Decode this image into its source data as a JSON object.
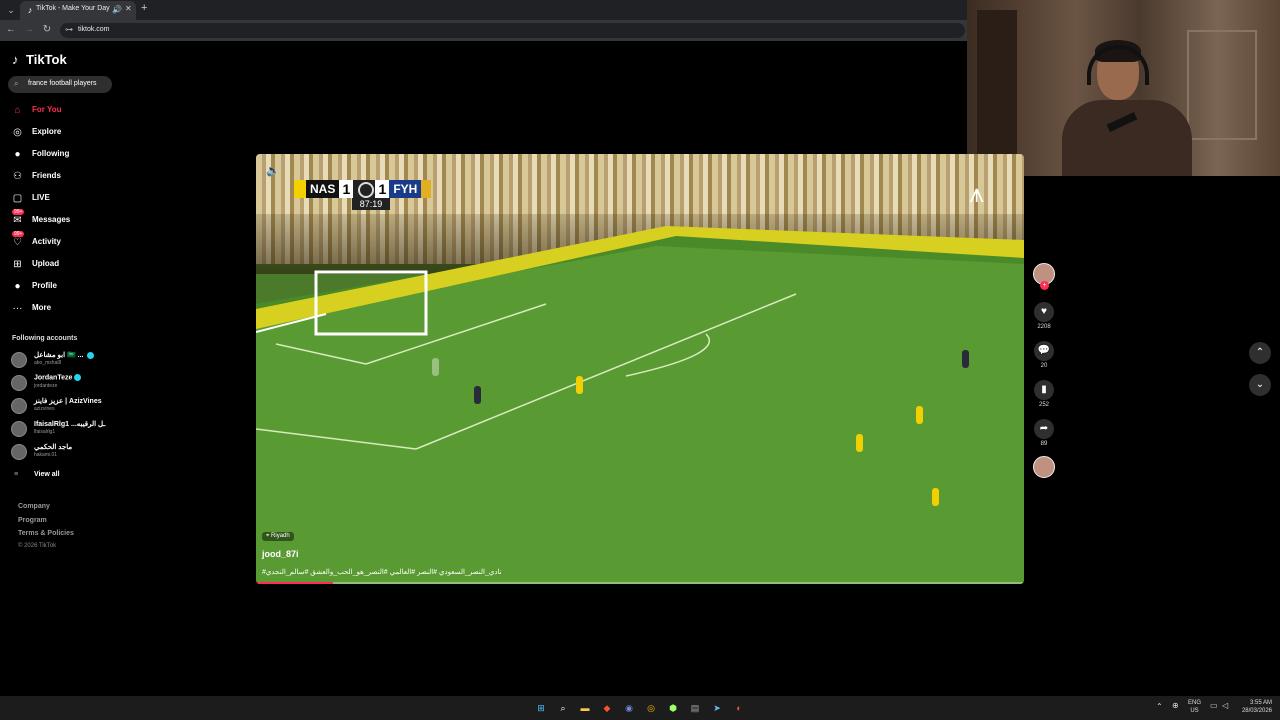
{
  "browser": {
    "tab_title": "TikTok - Make Your Day",
    "url": "tiktok.com"
  },
  "sidebar": {
    "search_value": "france football players",
    "nav": [
      {
        "label": "For You",
        "icon": "home-icon",
        "active": true
      },
      {
        "label": "Explore",
        "icon": "compass-icon"
      },
      {
        "label": "Following",
        "icon": "following-avatar-icon"
      },
      {
        "label": "Friends",
        "icon": "friends-icon"
      },
      {
        "label": "LIVE",
        "icon": "live-tv-icon"
      },
      {
        "label": "Messages",
        "icon": "message-icon",
        "badge": "99+"
      },
      {
        "label": "Activity",
        "icon": "activity-icon",
        "badge": "99+"
      },
      {
        "label": "Upload",
        "icon": "upload-plus-icon"
      },
      {
        "label": "Profile",
        "icon": "profile-avatar-icon"
      },
      {
        "label": "More",
        "icon": "more-dots-icon"
      }
    ],
    "following_title": "Following accounts",
    "accounts": [
      {
        "name": "ابو مشاعل 🇸🇦 ... ",
        "handle": "abo_mshal8",
        "verified": true
      },
      {
        "name": "JordanTeze",
        "handle": "jordanteze",
        "verified": true
      },
      {
        "name": "عزيز فاينز | AzizVines",
        "handle": "azizvines",
        "verified": false
      },
      {
        "name": "IfaisalRlg1 ...ـل الرقيبه",
        "handle": "lfaisalrlg1",
        "verified": false
      },
      {
        "name": "ماجد الحكمي",
        "handle": "hakami.01",
        "verified": false
      }
    ],
    "view_all": "View all",
    "footer": [
      "Company",
      "Program",
      "Terms & Policies"
    ],
    "copyright": "© 2026 TikTok"
  },
  "video": {
    "home_team": "NAS",
    "home_score": "1",
    "away_score": "1",
    "away_team": "FYH",
    "clock": "87:19",
    "location": "Riyadh",
    "author": "jood_87i",
    "caption": "#نادي_النصر_السعودي #النصر #العالمي #النصر_هو_الحب_والعشق #سالم_النجدي",
    "progress": 0.1
  },
  "actions": {
    "likes": "2208",
    "comments": "20",
    "saves": "252",
    "shares": "89"
  },
  "taskbar": {
    "lang_top": "ENG",
    "lang_bottom": "US",
    "time": "3:55 AM",
    "date": "28/03/2026"
  },
  "colors": {
    "accent": "#fe2c55",
    "home_kit": "#f0d000",
    "away_kit": "#2a2a3a"
  }
}
